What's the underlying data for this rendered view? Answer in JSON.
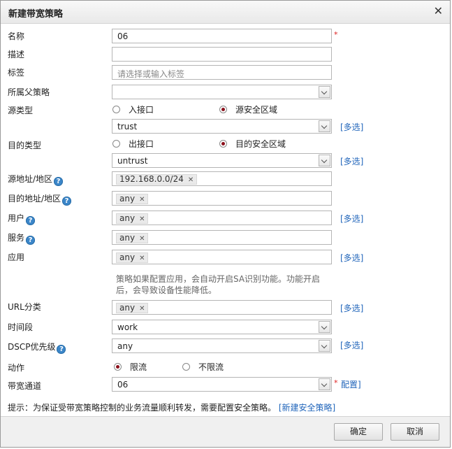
{
  "dialog": {
    "title": "新建带宽策略",
    "close_glyph": "✕"
  },
  "form": {
    "name": {
      "label": "名称",
      "value": "06",
      "required_mark": "*"
    },
    "desc": {
      "label": "描述",
      "value": ""
    },
    "tag": {
      "label": "标签",
      "placeholder": "请选择或输入标签"
    },
    "parent_policy": {
      "label": "所属父策略",
      "value": ""
    },
    "source_type": {
      "label": "源类型",
      "options": [
        "入接口",
        "源安全区域"
      ],
      "selected": "源安全区域",
      "zone_value": "trust",
      "multi_label": "[多选]"
    },
    "dest_type": {
      "label": "目的类型",
      "options": [
        "出接口",
        "目的安全区域"
      ],
      "selected": "目的安全区域",
      "zone_value": "untrust",
      "multi_label": "[多选]"
    },
    "src_addr": {
      "label": "源地址/地区",
      "tag": "192.168.0.0/24"
    },
    "dst_addr": {
      "label": "目的地址/地区",
      "tag": "any"
    },
    "user": {
      "label": "用户",
      "tag": "any",
      "multi_label": "[多选]"
    },
    "service": {
      "label": "服务",
      "tag": "any"
    },
    "application": {
      "label": "应用",
      "tag": "any",
      "multi_label": "[多选]",
      "hint": "策略如果配置应用，会自动开启SA识别功能。功能开启后，会导致设备性能降低。"
    },
    "url_category": {
      "label": "URL分类",
      "tag": "any",
      "multi_label": "[多选]"
    },
    "time_range": {
      "label": "时间段",
      "value": "work"
    },
    "dscp": {
      "label": "DSCP优先级",
      "value": "any",
      "multi_label": "[多选]"
    },
    "action": {
      "label": "动作",
      "options": [
        "限流",
        "不限流"
      ],
      "selected": "限流"
    },
    "channel": {
      "label": "带宽通道",
      "value": "06",
      "required_mark": "*",
      "config_label": "配置]"
    },
    "help_glyph": "?",
    "tag_remove_glyph": "✕"
  },
  "tip": {
    "text": "提示：为保证受带宽策略控制的业务流量顺利转发，需要配置安全策略。",
    "link": "[新建安全策略]"
  },
  "footer": {
    "ok_label": "确定",
    "cancel_label": "取消"
  }
}
